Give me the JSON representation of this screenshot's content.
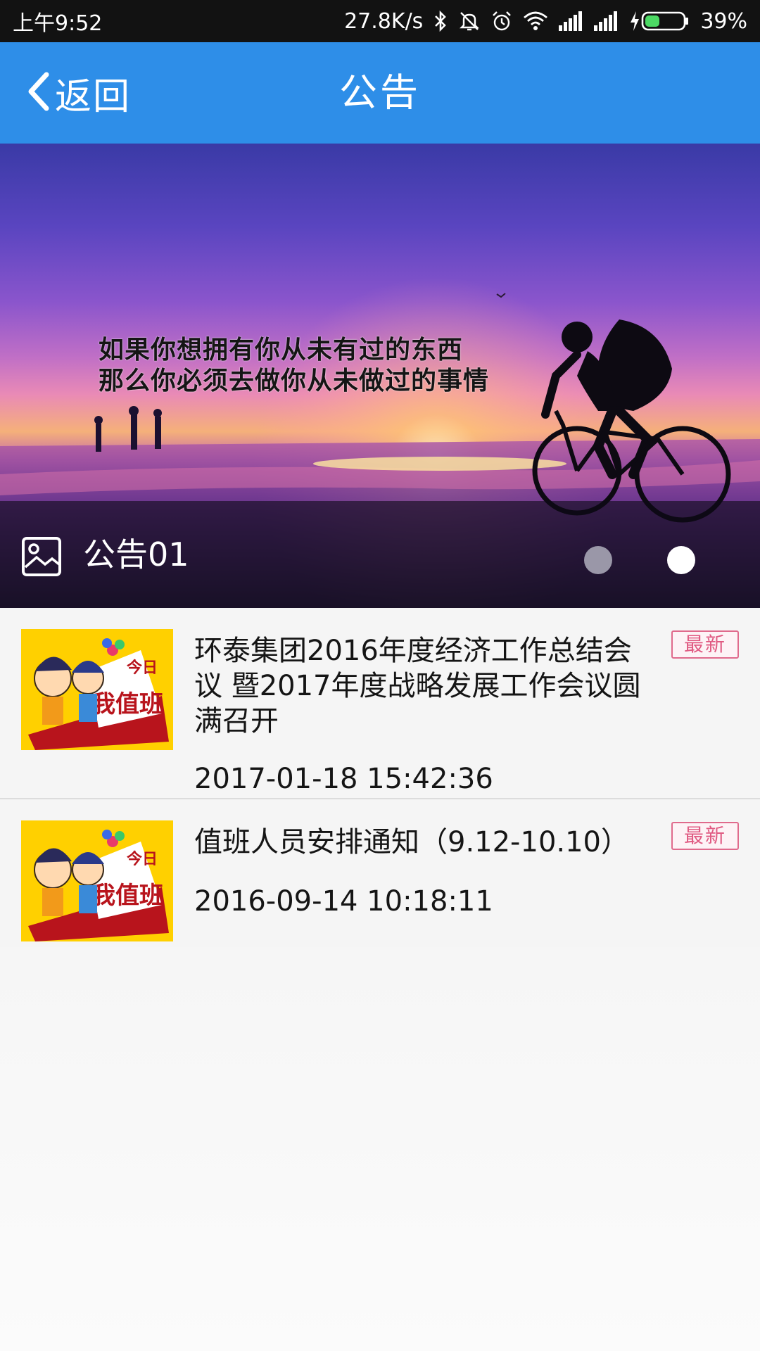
{
  "status_bar": {
    "time": "上午9:52",
    "network_speed": "27.8K/s",
    "battery_percent": "39%",
    "battery_level": 0.39,
    "icons": [
      "bluetooth-icon",
      "mute-icon",
      "alarm-icon",
      "wifi-icon",
      "signal-icon",
      "signal-icon",
      "charging-icon",
      "battery-icon"
    ]
  },
  "header": {
    "back_label": "返回",
    "title": "公告"
  },
  "banner": {
    "quote_line_1": "如果你想拥有你从未有过的东西",
    "quote_line_2": "那么你必须去做你从未做过的事情",
    "caption": "公告01",
    "slide_count": 2,
    "active_slide": 2
  },
  "notices": [
    {
      "title": "环泰集团2016年度经济工作总结会议 暨2017年度战略发展工作会议圆满召开",
      "date": "2017-01-18 15:42:36",
      "badge": "最新"
    },
    {
      "title": "值班人员安排通知（9.12-10.10）",
      "date": "2016-09-14 10:18:11",
      "badge": "最新"
    }
  ],
  "colors": {
    "header_bg": "#2e8ee8",
    "status_bg": "#121212",
    "badge": "#e05a82",
    "thumb_bg": "#ffd400"
  }
}
